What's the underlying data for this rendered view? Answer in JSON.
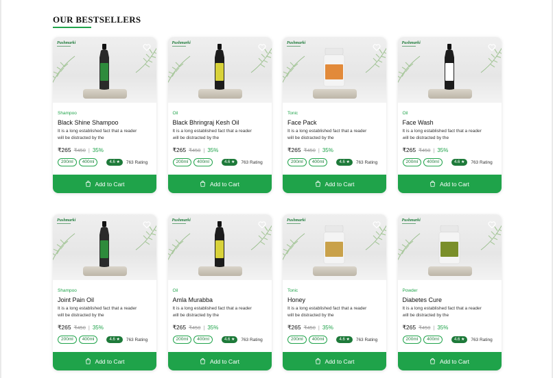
{
  "section": {
    "title": "OUR BESTSELLERS"
  },
  "brand_name": "Pushmarki",
  "colors": {
    "accent": "#1fa34a",
    "accent_dark": "#1e7a3a"
  },
  "cart_label": "Add  to Cart",
  "products": [
    {
      "category": "Shampoo",
      "name": "Black Shine Shampoo",
      "description": "It is a long established fact that a reader will be distracted by the",
      "price": "₹265",
      "mrp": "₹450",
      "separator": "|",
      "discount": "35%",
      "sizes": [
        "200ml",
        "400ml"
      ],
      "rating": "4.6 ★",
      "rating_count": "763 Rating",
      "image_kind": "bottle",
      "product_color": "#2a2a2a",
      "label_color": "#2e8b3c"
    },
    {
      "category": "Oil",
      "name": "Black Bhringraj Kesh Oil",
      "description": "It is a long established fact that a reader will be distracted by the",
      "price": "₹265",
      "mrp": "₹450",
      "separator": "|",
      "discount": "35%",
      "sizes": [
        "200ml",
        "400ml"
      ],
      "rating": "4.6 ★",
      "rating_count": "763 Rating",
      "image_kind": "bottle",
      "product_color": "#1c1c1c",
      "label_color": "#d8d23a"
    },
    {
      "category": "Tonic",
      "name": "Face Pack",
      "description": "It is a long established fact that a reader will be distracted by the",
      "price": "₹265",
      "mrp": "₹450",
      "separator": "|",
      "discount": "35%",
      "sizes": [
        "200ml",
        "400ml"
      ],
      "rating": "4.6 ★",
      "rating_count": "763 Rating",
      "image_kind": "jar",
      "product_color": "#f4f4f4",
      "label_color": "#e28a3a"
    },
    {
      "category": "Oil",
      "name": "Face Wash",
      "description": "It is a long established fact that a reader will be distracted by the",
      "price": "₹265",
      "mrp": "₹450",
      "separator": "|",
      "discount": "35%",
      "sizes": [
        "200ml",
        "400ml"
      ],
      "rating": "4.6 ★",
      "rating_count": "763 Rating",
      "image_kind": "bottle",
      "product_color": "#1c1c1c",
      "label_color": "#ffffff"
    },
    {
      "category": "Shampoo",
      "name": "Joint Pain Oil",
      "description": "It is a long established fact that a reader will be distracted by the",
      "price": "₹265",
      "mrp": "₹450",
      "separator": "|",
      "discount": "35%",
      "sizes": [
        "200ml",
        "400ml"
      ],
      "rating": "4.6 ★",
      "rating_count": "763 Rating",
      "image_kind": "bottle",
      "product_color": "#2a2a2a",
      "label_color": "#2e8b3c"
    },
    {
      "category": "Oil",
      "name": "Amla Murabba",
      "description": "It is a long established fact that a reader will be distracted by the",
      "price": "₹265",
      "mrp": "₹450",
      "separator": "|",
      "discount": "35%",
      "sizes": [
        "200ml",
        "400ml"
      ],
      "rating": "4.6 ★",
      "rating_count": "763 Rating",
      "image_kind": "bottle",
      "product_color": "#1c1c1c",
      "label_color": "#d8d23a"
    },
    {
      "category": "Tonic",
      "name": "Honey",
      "description": "It is a long established fact that a reader will be distracted by the",
      "price": "₹265",
      "mrp": "₹450",
      "separator": "|",
      "discount": "35%",
      "sizes": [
        "200ml",
        "400ml"
      ],
      "rating": "4.6 ★",
      "rating_count": "763 Rating",
      "image_kind": "jar",
      "product_color": "#f4f4f4",
      "label_color": "#c9a14a"
    },
    {
      "category": "Powder",
      "name": "Diabetes Cure",
      "description": "It is a long established fact that a reader will be distracted by the",
      "price": "₹265",
      "mrp": "₹450",
      "separator": "|",
      "discount": "35%",
      "sizes": [
        "200ml",
        "400ml"
      ],
      "rating": "4.6 ★",
      "rating_count": "763 Rating",
      "image_kind": "jar",
      "product_color": "#f4f4f4",
      "label_color": "#7a8f2a"
    }
  ]
}
